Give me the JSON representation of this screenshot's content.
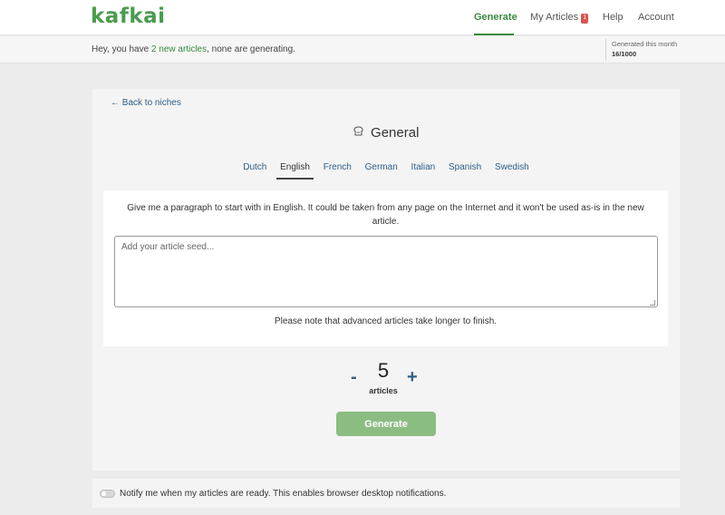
{
  "header": {
    "logo": "kafkai",
    "nav": {
      "generate": "Generate",
      "my_articles": "My Articles",
      "my_articles_badge": "1",
      "help": "Help",
      "account": "Account"
    },
    "active_nav": "Generate"
  },
  "infobar": {
    "prefix": "Hey, you have ",
    "link": "2 new articles",
    "suffix": ", none are generating.",
    "generated_label": "Generated this month",
    "generated_value": "16/1000"
  },
  "main": {
    "back_link": "← Back to niches",
    "title_icon": "bread-icon",
    "title": "General",
    "tabs": [
      "Dutch",
      "English",
      "French",
      "German",
      "Italian",
      "Spanish",
      "Swedish"
    ],
    "active_tab": "English",
    "prompt": "Give me a paragraph to start with in English. It could be taken from any page on the Internet and it won't be used as-is in the new article.",
    "seed_placeholder": "Add your article seed...",
    "seed_value": "",
    "note": "Please note that advanced articles take longer to finish.",
    "stepper": {
      "minus": "-",
      "count": "5",
      "plus": "+",
      "unit": "articles"
    },
    "generate_button": "Generate"
  },
  "notification": {
    "toggle_on": false,
    "text": "Notify me when my articles are ready. This enables browser desktop notifications."
  },
  "colors": {
    "brand_green": "#3a8a3f",
    "link_blue": "#2c5f8a",
    "button_green": "#8bbd83",
    "badge_red": "#d9534f"
  }
}
